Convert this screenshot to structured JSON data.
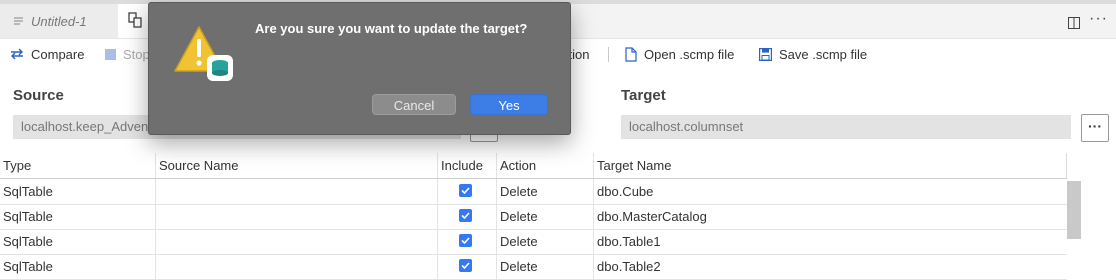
{
  "tabs": [
    {
      "label": "Untitled-1",
      "icon": "file-lines-icon"
    },
    {
      "label": "",
      "icon": "schema-compare-icon"
    }
  ],
  "editor_actions": {
    "split_icon": "split-editor-icon",
    "more_label": "···"
  },
  "toolbar": {
    "compare_label": "Compare",
    "stop_label": "Stop",
    "apply_label_partial": "ction",
    "open_label": "Open .scmp file",
    "save_label": "Save .scmp file"
  },
  "source": {
    "label": "Source",
    "value": "localhost.keep_Adven",
    "browse_label": "..."
  },
  "target": {
    "label": "Target",
    "value": "localhost.columnset",
    "browse_label": "···"
  },
  "grid": {
    "headers": {
      "type": "Type",
      "source_name": "Source Name",
      "include": "Include",
      "action": "Action",
      "target_name": "Target Name"
    },
    "rows": [
      {
        "type": "SqlTable",
        "source_name": "",
        "include": true,
        "action": "Delete",
        "target_name": "dbo.Cube"
      },
      {
        "type": "SqlTable",
        "source_name": "",
        "include": true,
        "action": "Delete",
        "target_name": "dbo.MasterCatalog"
      },
      {
        "type": "SqlTable",
        "source_name": "",
        "include": true,
        "action": "Delete",
        "target_name": "dbo.Table1"
      },
      {
        "type": "SqlTable",
        "source_name": "",
        "include": true,
        "action": "Delete",
        "target_name": "dbo.Table2"
      }
    ]
  },
  "dialog": {
    "message": "Are you sure you want to update the target?",
    "cancel_label": "Cancel",
    "yes_label": "Yes",
    "icon": "warning-icon"
  },
  "colors": {
    "accent": "#3d7ee6",
    "checkbox": "#3478f6",
    "dialog_bg": "#6f6f6f",
    "warning": "#f1c232"
  }
}
